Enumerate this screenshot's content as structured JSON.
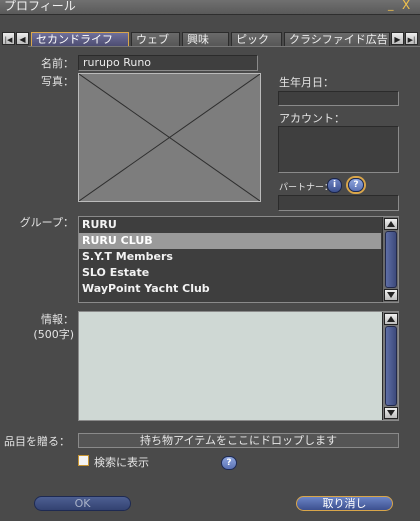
{
  "window": {
    "title": "プロフィール",
    "minimize_label": "_",
    "close_label": "X"
  },
  "nav": {
    "first_label": "|◀",
    "prev_label": "◀",
    "next_label": "▶",
    "last_label": "▶|"
  },
  "tabs": [
    {
      "label": "セカンドライフ",
      "active": true
    },
    {
      "label": "ウェブ",
      "active": false
    },
    {
      "label": "興味",
      "active": false
    },
    {
      "label": "ピック",
      "active": false
    },
    {
      "label": "クラシファイド広告",
      "active": false
    }
  ],
  "profile": {
    "name_label": "名前：",
    "name_value": "rurupo Runo",
    "photo_label": "写真：",
    "birthdate_label": "生年月日：",
    "birthdate_value": "",
    "account_label": "アカウント：",
    "account_value": "",
    "partner_label": "パートナー：",
    "partner_value": "",
    "info_icon": "i",
    "help_icon": "?"
  },
  "groups": {
    "label": "グループ：",
    "items": [
      "RURU",
      "RURU CLUB",
      "S.Y.T Members",
      "SLO Estate",
      "WayPoint Yacht Club"
    ],
    "selected_index": 1
  },
  "about": {
    "label_line1": "情報：",
    "label_line2": "(500字)",
    "value": ""
  },
  "give_item": {
    "label": "品目を贈る：",
    "drop_text": "持ち物アイテムをここにドロップします"
  },
  "search": {
    "label": "検索に表示",
    "checked": false,
    "help_icon": "?"
  },
  "buttons": {
    "ok_label": "OK",
    "cancel_label": "取り消し"
  }
}
